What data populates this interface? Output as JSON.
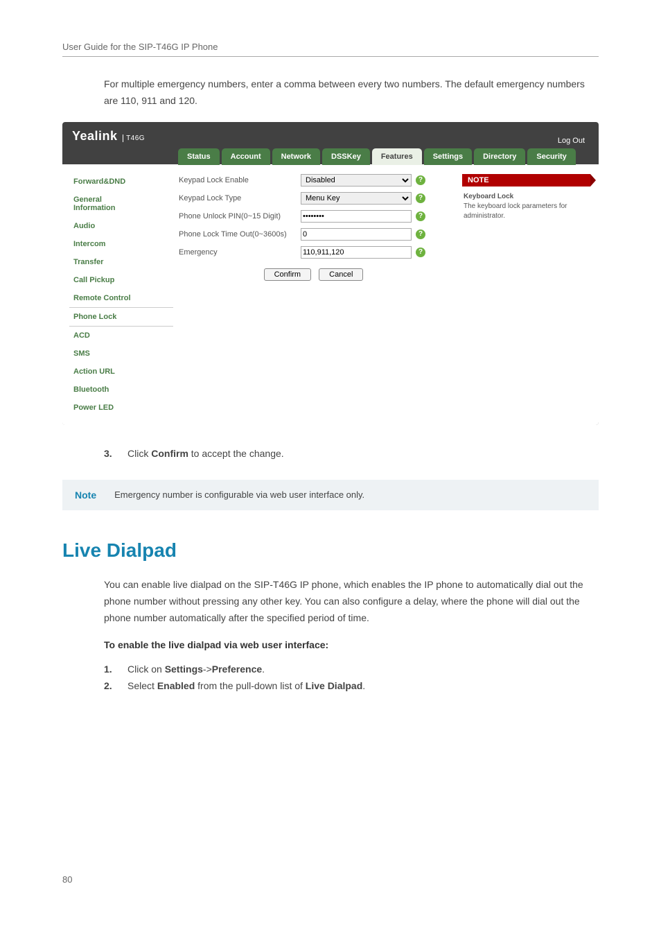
{
  "doc": {
    "header_title": "User Guide for the SIP-T46G IP Phone",
    "intro_para": "For multiple emergency numbers, enter a comma between every two numbers. The default emergency numbers are 110, 911 and 120.",
    "step3_num": "3.",
    "step3_textA": "Click ",
    "step3_confirm": "Confirm",
    "step3_textB": " to accept the change.",
    "note_label": "Note",
    "note_text": "Emergency number is configurable via web user interface only.",
    "section_title": "Live Dialpad",
    "section_para": "You can enable live dialpad on the SIP-T46G IP phone, which enables the IP phone to automatically dial out the phone number without pressing any other key. You can also configure a delay, where the phone will dial out the phone number automatically after the specified period of time.",
    "sub_bold": "To enable the live dialpad via web user interface:",
    "s1_num": "1.",
    "s1_a": "Click on ",
    "s1_b": "Settings",
    "s1_c": "->",
    "s1_d": "Preference",
    "s1_e": ".",
    "s2_num": "2.",
    "s2_a": "Select ",
    "s2_b": "Enabled",
    "s2_c": " from the pull-down list of ",
    "s2_d": "Live Dialpad",
    "s2_e": ".",
    "page_number": "80"
  },
  "ui": {
    "brand": "Yealink",
    "brand_sub": "T46G",
    "logout": "Log Out",
    "tabs": {
      "status": "Status",
      "account": "Account",
      "network": "Network",
      "dsskey": "DSSKey",
      "features": "Features",
      "settings": "Settings",
      "directory": "Directory",
      "security": "Security"
    },
    "side": {
      "forward": "Forward&DND",
      "general1": "General",
      "general2": "Information",
      "audio": "Audio",
      "intercom": "Intercom",
      "transfer": "Transfer",
      "callpickup": "Call Pickup",
      "remote": "Remote Control",
      "phonelock": "Phone Lock",
      "acd": "ACD",
      "sms": "SMS",
      "actionurl": "Action URL",
      "bluetooth": "Bluetooth",
      "powerled": "Power LED"
    },
    "form": {
      "r1_label": "Keypad Lock Enable",
      "r1_value": "Disabled",
      "r2_label": "Keypad Lock Type",
      "r2_value": "Menu Key",
      "r3_label": "Phone Unlock PIN(0~15 Digit)",
      "r3_value": "••••••••",
      "r4_label": "Phone Lock Time Out(0~3600s)",
      "r4_value": "0",
      "r5_label": "Emergency",
      "r5_value": "110,911,120",
      "confirm": "Confirm",
      "cancel": "Cancel"
    },
    "note": {
      "header": "NOTE",
      "title": "Keyboard Lock",
      "body": "The keyboard lock parameters for administrator."
    }
  }
}
